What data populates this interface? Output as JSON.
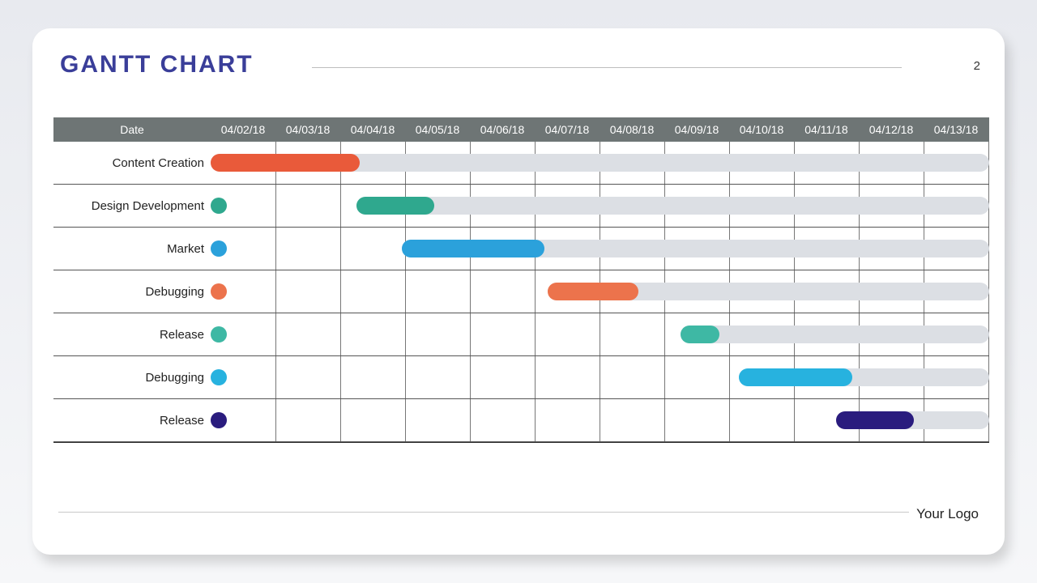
{
  "title": "GANTT CHART",
  "page_number": "2",
  "footer_logo": "Your Logo",
  "header_label": "Date",
  "chart_data": {
    "type": "bar",
    "title": "GANTT CHART",
    "xlabel": "Date",
    "ylabel": "",
    "categories": [
      "04/02/18",
      "04/03/18",
      "04/04/18",
      "04/05/18",
      "04/06/18",
      "04/07/18",
      "04/08/18",
      "04/09/18",
      "04/10/18",
      "04/11/18",
      "04/12/18",
      "04/13/18"
    ],
    "tasks": [
      {
        "name": "Content Creation",
        "start": "04/02/18",
        "end": "04/04/18",
        "start_idx": 0,
        "duration_days": 2.3,
        "color": "#e95a3a"
      },
      {
        "name": "Design Development",
        "start": "04/04/18",
        "end": "04/05/18",
        "start_idx": 2.25,
        "duration_days": 1.2,
        "color": "#2fa88e",
        "marker": true
      },
      {
        "name": "Market",
        "start": "04/05/18",
        "end": "04/07/18",
        "start_idx": 2.95,
        "duration_days": 2.2,
        "color": "#2ba1db",
        "marker": true
      },
      {
        "name": "Debugging",
        "start": "04/07/18",
        "end": "04/08/18",
        "start_idx": 5.2,
        "duration_days": 1.4,
        "color": "#ec734c",
        "marker": true
      },
      {
        "name": "Release",
        "start": "04/09/18",
        "end": "04/09/18",
        "start_idx": 7.25,
        "duration_days": 0.6,
        "color": "#3eb8a4",
        "marker": true
      },
      {
        "name": "Debugging",
        "start": "04/10/18",
        "end": "04/11/18",
        "start_idx": 8.15,
        "duration_days": 1.75,
        "color": "#27b2df",
        "marker": true
      },
      {
        "name": "Release",
        "start": "04/11/18",
        "end": "04/12/18",
        "start_idx": 9.65,
        "duration_days": 1.2,
        "color": "#2a1c7e",
        "marker": true
      }
    ]
  }
}
